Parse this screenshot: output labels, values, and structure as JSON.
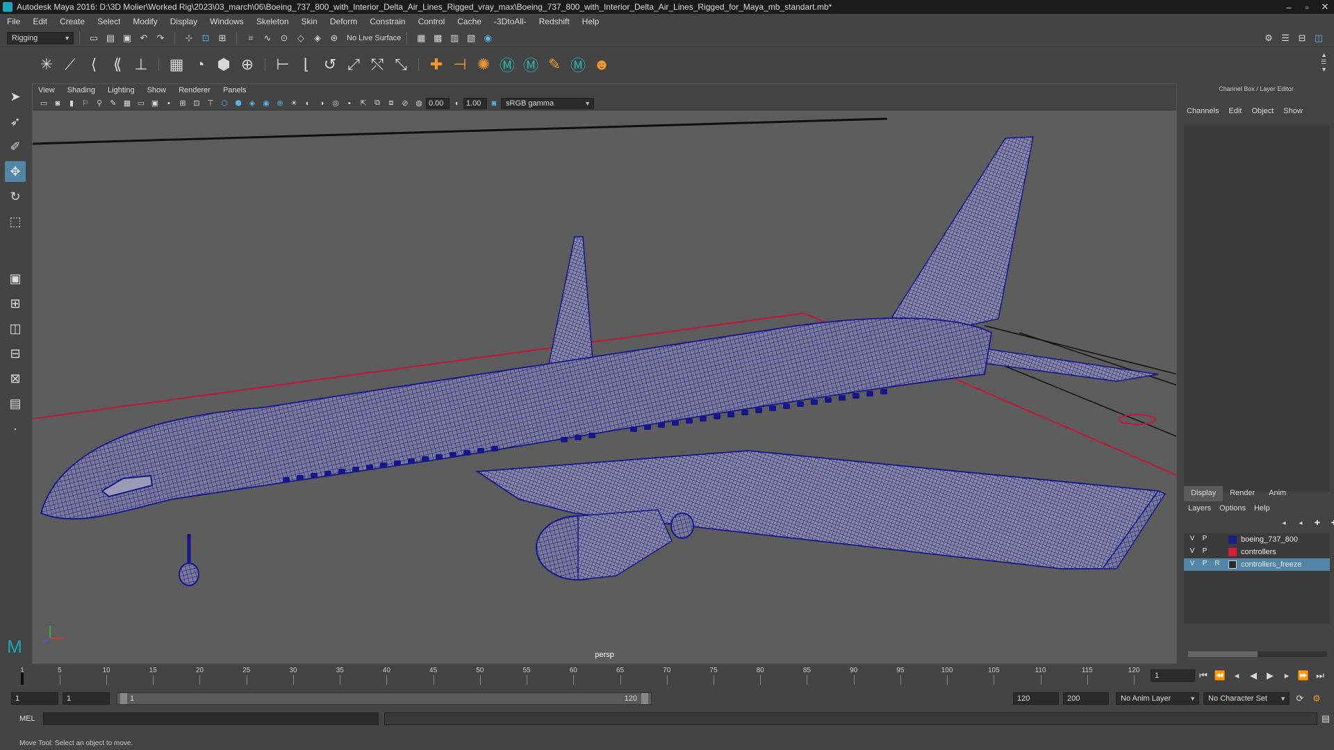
{
  "window": {
    "title": "Autodesk Maya 2016: D:\\3D Molier\\Worked Rig\\2023\\03_march\\06\\Boeing_737_800_with_Interior_Delta_Air_Lines_Rigged_vray_max\\Boeing_737_800_with_Interior_Delta_Air_Lines_Rigged_for_Maya_mb_standart.mb*",
    "minimize": "–",
    "maximize": "▫",
    "close": "✕"
  },
  "menubar": [
    "File",
    "Edit",
    "Create",
    "Select",
    "Modify",
    "Display",
    "Windows",
    "Skeleton",
    "Skin",
    "Deform",
    "Constrain",
    "Control",
    "Cache",
    "-3DtoAll-",
    "Redshift",
    "Help"
  ],
  "toolbar": {
    "mode": "Rigging",
    "live_surface": "No Live Surface"
  },
  "panel_menu": [
    "View",
    "Shading",
    "Lighting",
    "Show",
    "Renderer",
    "Panels"
  ],
  "viewport_toolbar": {
    "exposure": "0.00",
    "gamma": "1.00",
    "color_space": "sRGB gamma"
  },
  "viewport": {
    "camera": "persp"
  },
  "channel_box": {
    "title": "Channel Box / Layer Editor",
    "menu": [
      "Channels",
      "Edit",
      "Object",
      "Show"
    ]
  },
  "layer_editor": {
    "tabs": [
      "Display",
      "Render",
      "Anim"
    ],
    "submenu": [
      "Layers",
      "Options",
      "Help"
    ],
    "layers": [
      {
        "v": "V",
        "p": "P",
        "r": "",
        "color": "#1a1f8a",
        "name": "boeing_737_800",
        "selected": false
      },
      {
        "v": "V",
        "p": "P",
        "r": "",
        "color": "#d2203a",
        "name": "controllers",
        "selected": false
      },
      {
        "v": "V",
        "p": "P",
        "r": "R",
        "color": "#2a2a2a",
        "name": "controllers_freeze",
        "selected": true
      }
    ]
  },
  "timeline": {
    "ticks": [
      "1",
      "5",
      "10",
      "15",
      "20",
      "25",
      "30",
      "35",
      "40",
      "45",
      "50",
      "55",
      "60",
      "65",
      "70",
      "75",
      "80",
      "85",
      "90",
      "95",
      "100",
      "105",
      "110",
      "115",
      "120"
    ],
    "current_frame": "1"
  },
  "range": {
    "start": "1",
    "playback_start": "1",
    "slider_start": "1",
    "slider_end": "120",
    "playback_end": "120",
    "end": "200",
    "anim_layer": "No Anim Layer",
    "character_set": "No Character Set"
  },
  "command_line": {
    "label": "MEL"
  },
  "help_line": "Move Tool: Select an object to move."
}
